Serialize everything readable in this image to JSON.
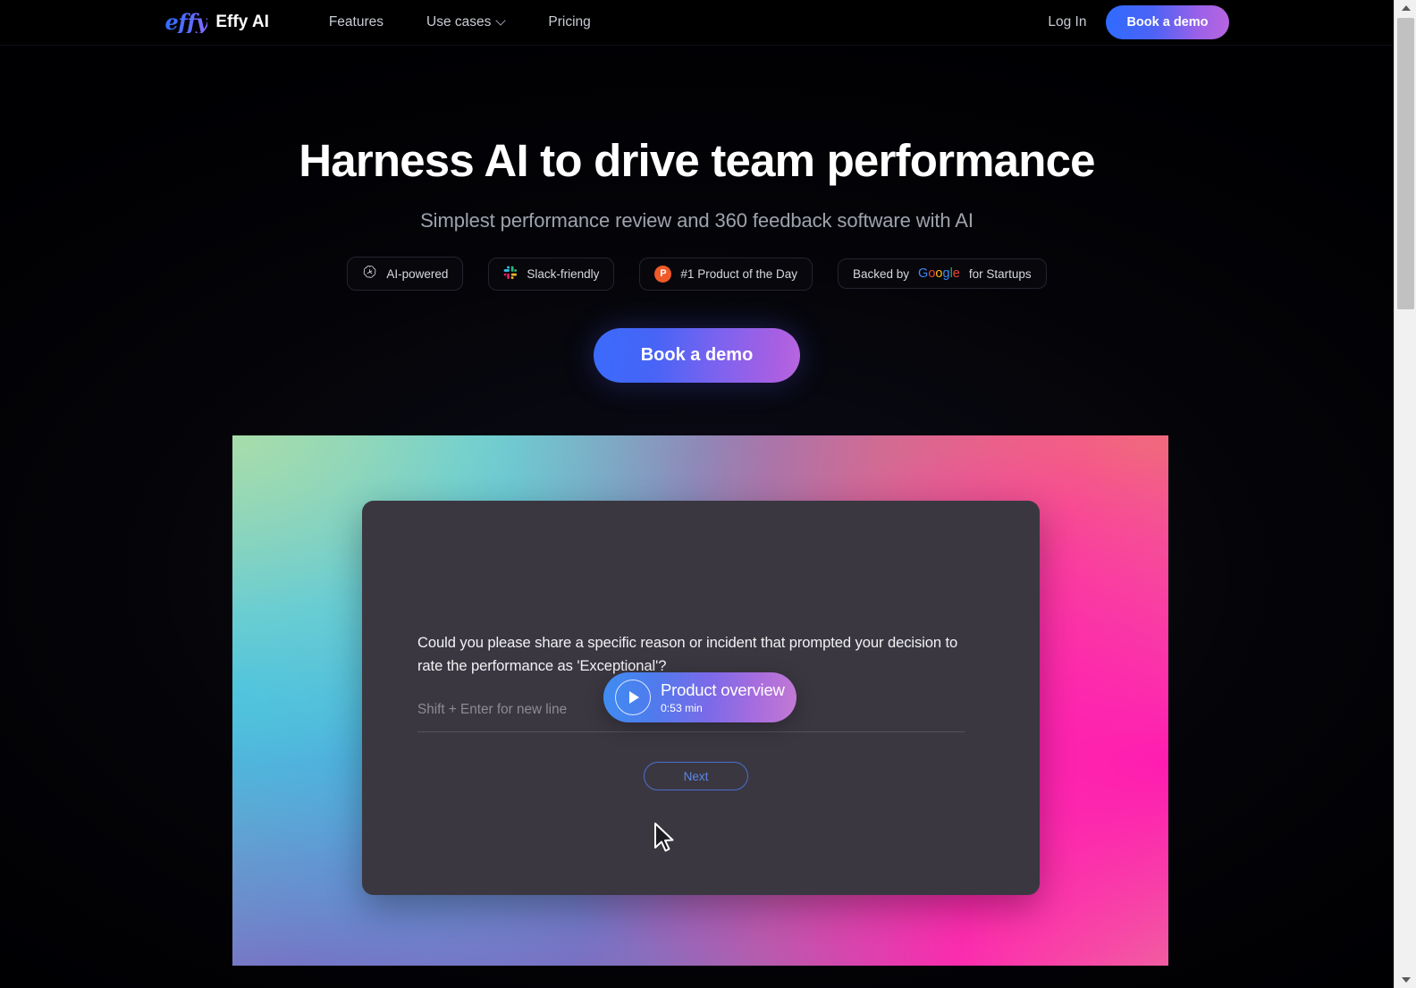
{
  "navbar": {
    "brand_mark": "effy",
    "brand_name": "Effy AI",
    "links": [
      {
        "label": "Features",
        "has_caret": false
      },
      {
        "label": "Use cases",
        "has_caret": true
      },
      {
        "label": "Pricing",
        "has_caret": false
      }
    ],
    "login_label": "Log In",
    "cta_label": "Book a demo"
  },
  "hero": {
    "headline": "Harness AI to drive team performance",
    "subheadline": "Simplest performance review and 360 feedback software with AI",
    "cta_label": "Book a demo"
  },
  "badges": [
    {
      "icon": "openai-logo-icon",
      "label": "AI-powered"
    },
    {
      "icon": "slack-logo-icon",
      "label": "Slack-friendly"
    },
    {
      "icon": "product-hunt-icon",
      "icon_letter": "P",
      "label": "#1 Product of the Day"
    },
    {
      "icon": "none",
      "label_prefix": "Backed by",
      "google_letters": [
        {
          "char": "G",
          "color": "#4285F4"
        },
        {
          "char": "o",
          "color": "#EA4335"
        },
        {
          "char": "o",
          "color": "#FBBC05"
        },
        {
          "char": "g",
          "color": "#4285F4"
        },
        {
          "char": "l",
          "color": "#34A853"
        },
        {
          "char": "e",
          "color": "#EA4335"
        }
      ],
      "label_suffix": "for Startups"
    }
  ],
  "video": {
    "question": "Could you please share a specific reason or incident that prompted your decision to rate the performance as 'Exceptional'?",
    "answer_placeholder": "Shift + Enter for new line",
    "next_label": "Next",
    "overview_title": "Product overview",
    "overview_duration": "0:53 min"
  },
  "colors": {
    "page_background": "#000002",
    "accent_blue": "#3b6bfb",
    "accent_purple": "#b867de",
    "product_hunt_orange": "#f05a28",
    "card_background": "#3a3741",
    "next_border": "#4a6fd0"
  }
}
